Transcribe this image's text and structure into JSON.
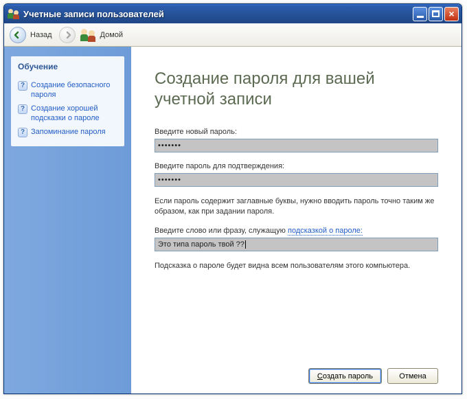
{
  "titlebar": {
    "title": "Учетные записи пользователей"
  },
  "toolbar": {
    "back": "Назад",
    "home": "Домой"
  },
  "sidebar": {
    "heading": "Обучение",
    "items": [
      {
        "label": "Создание безопасного пароля"
      },
      {
        "label": "Создание хорошей подсказки о пароле"
      },
      {
        "label": "Запоминание пароля"
      }
    ]
  },
  "main": {
    "heading": "Создание пароля для вашей учетной записи",
    "new_password_label": "Введите новый пароль:",
    "new_password_value": "•••••••",
    "confirm_password_label": "Введите пароль для подтверждения:",
    "confirm_password_value": "•••••••",
    "caps_note": "Если пароль содержит заглавные буквы, нужно вводить пароль точно таким же образом, как при задании пароля.",
    "hint_label_prefix": "Введите слово или фразу, служащую ",
    "hint_label_link": "подсказкой о пароле:",
    "hint_value": "Это типа пароль твой ??",
    "hint_visible_note": "Подсказка о пароле будет видна всем пользователям этого компьютера."
  },
  "buttons": {
    "create_prefix": "С",
    "create_rest": "оздать пароль",
    "cancel": "Отмена"
  }
}
